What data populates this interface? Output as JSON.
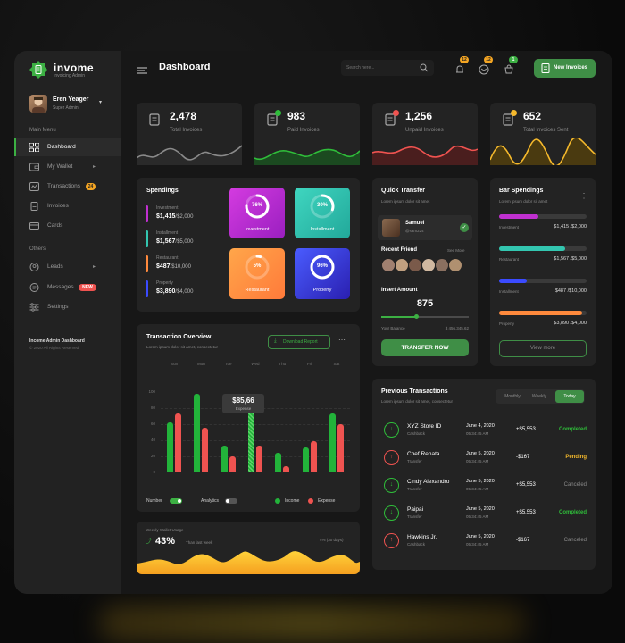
{
  "app": {
    "brand": "invome",
    "brand_sub": "Invoicing Admin",
    "page_title": "Dashboard",
    "search_placeholder": "Search here...",
    "new_invoices_button": "New Invoices",
    "notifications": {
      "bell": "12",
      "mail": "12",
      "cart": "1"
    },
    "accent": "#3cb043"
  },
  "profile": {
    "name": "Eren Yeager",
    "role": "Super Admin"
  },
  "sidebar": {
    "main_menu_label": "Main Menu",
    "items": [
      {
        "label": "Dashboard",
        "icon": "grid-icon"
      },
      {
        "label": "My Wallet",
        "icon": "wallet-icon"
      },
      {
        "label": "Transactions",
        "icon": "chart-icon",
        "badge": "24"
      },
      {
        "label": "Invoices",
        "icon": "invoice-icon"
      },
      {
        "label": "Cards",
        "icon": "card-icon"
      }
    ],
    "others_label": "Others",
    "others": [
      {
        "label": "Leads",
        "icon": "user-icon"
      },
      {
        "label": "Messages",
        "icon": "message-icon",
        "badge": "NEW"
      },
      {
        "label": "Settings",
        "icon": "sliders-icon"
      }
    ],
    "footer_title": "Income Admin Dashboard",
    "footer_copy": "© 2020 All Rights Reserved"
  },
  "stats": [
    {
      "value": "2,478",
      "label": "Total Invoices",
      "color": "#8a8a8a"
    },
    {
      "value": "983",
      "label": "Paid Invoices",
      "color": "#2fbd3a"
    },
    {
      "value": "1,256",
      "label": "Unpaid Invoices",
      "color": "#ef5350"
    },
    {
      "value": "652",
      "label": "Total Invoices Sent",
      "color": "#f5b92c"
    }
  ],
  "spendings": {
    "title": "Spendings",
    "rows": [
      {
        "name": "Investment",
        "value": "$1,415",
        "total": "/$2,000",
        "color": "#c030d0"
      },
      {
        "name": "Installment",
        "value": "$1,567",
        "total": "/$5,000",
        "color": "#33c6b0"
      },
      {
        "name": "Restaurant",
        "value": "$487",
        "total": "/$10,000",
        "color": "#ff8a3d"
      },
      {
        "name": "Property",
        "value": "$3,890",
        "total": "/$4,000",
        "color": "#3b4bff"
      }
    ],
    "tiles": [
      {
        "label": "Investment",
        "pct": "76%",
        "frac": 0.76
      },
      {
        "label": "Installment",
        "pct": "30%",
        "frac": 0.3
      },
      {
        "label": "Restaurant",
        "pct": "5%",
        "frac": 0.05
      },
      {
        "label": "Property",
        "pct": "96%",
        "frac": 0.96
      }
    ]
  },
  "quick_transfer": {
    "title": "Quick Transfer",
    "subtitle": "Lorem ipsum dolor sit amet",
    "recipient_name": "Samuel",
    "recipient_id": "@sam224",
    "recent_friend_label": "Recent Friend",
    "see_more": "See More",
    "insert_amount_label": "Insert Amount",
    "amount": "875",
    "your_balance_label": "Your Balance",
    "balance": "$ 456,345.62",
    "slider_fraction": 0.4,
    "button": "TRANSFER NOW"
  },
  "bar_spendings": {
    "title": "Bar Spendings",
    "subtitle": "Lorem ipsum dolor sit amet",
    "rows": [
      {
        "name": "Investment",
        "value": "$1,415 /$2,000",
        "frac": 0.45,
        "color": "#c030d0"
      },
      {
        "name": "Restaurant",
        "value": "$1,567 /$5,000",
        "frac": 0.75,
        "color": "#33c6b0"
      },
      {
        "name": "Installment",
        "value": "$487 /$10,000",
        "frac": 0.32,
        "color": "#3b4bff"
      },
      {
        "name": "Property",
        "value": "$3,890 /$4,000",
        "frac": 0.95,
        "color": "#ff8a3d"
      }
    ],
    "view_more": "View more"
  },
  "transaction_overview": {
    "title": "Transaction Overview",
    "subtitle": "Lorem ipsum dolor sit amet, consectetur",
    "download_button": "Download Report",
    "tooltip_value": "$85,66",
    "tooltip_label": "Expense",
    "toggle_number_label": "Number",
    "toggle_analytics_label": "Analytics",
    "legend_income": "Income",
    "legend_expense": "Expense"
  },
  "chart_data": {
    "type": "bar",
    "categories": [
      "Sun",
      "Mon",
      "Tue",
      "Wed",
      "Thu",
      "Fri",
      "Sat"
    ],
    "yticks": [
      "0",
      "20",
      "40",
      "60",
      "80",
      "100"
    ],
    "ylim": [
      0,
      100
    ],
    "series": [
      {
        "name": "Income",
        "color": "#22b33a",
        "values": [
          62,
          98,
          33,
          78,
          25,
          31,
          73
        ]
      },
      {
        "name": "Expense",
        "color": "#ef5350",
        "values": [
          73,
          56,
          20,
          33,
          8,
          39,
          60
        ]
      }
    ]
  },
  "weekly_wallet": {
    "title": "Weekly Wallet Usage",
    "percent": "43%",
    "compare": "Than last week",
    "trend": "4% (30 days)"
  },
  "previous_transactions": {
    "title": "Previous Transactions",
    "subtitle": "Lorem ipsum dolor sit amet, consectetur",
    "tabs": [
      "Monthly",
      "Weekly",
      "Today"
    ],
    "rows": [
      {
        "name": "XYZ Store ID",
        "type": "Cashback",
        "date": "June 4, 2020",
        "time": "05:34:45 AM",
        "amount": "+$5,553",
        "status": "Completed",
        "color": "#2fbd3a",
        "dir": "in"
      },
      {
        "name": "Chef Renata",
        "type": "Transfer",
        "date": "June 5, 2020",
        "time": "05:34:45 AM",
        "amount": "-$167",
        "status": "Pending",
        "color": "#f5b92c",
        "dir": "out"
      },
      {
        "name": "Cindy Alexandro",
        "type": "Transfer",
        "date": "June 5, 2020",
        "time": "05:34:45 AM",
        "amount": "+$5,553",
        "status": "Canceled",
        "color": "#8a8a8a",
        "dir": "in"
      },
      {
        "name": "Paipai",
        "type": "Transfer",
        "date": "June 5, 2020",
        "time": "05:34:45 AM",
        "amount": "+$5,553",
        "status": "Completed",
        "color": "#2fbd3a",
        "dir": "in"
      },
      {
        "name": "Hawkins Jr.",
        "type": "Cashback",
        "date": "June 5, 2020",
        "time": "05:34:45 AM",
        "amount": "-$167",
        "status": "Canceled",
        "color": "#8a8a8a",
        "dir": "out"
      }
    ]
  }
}
